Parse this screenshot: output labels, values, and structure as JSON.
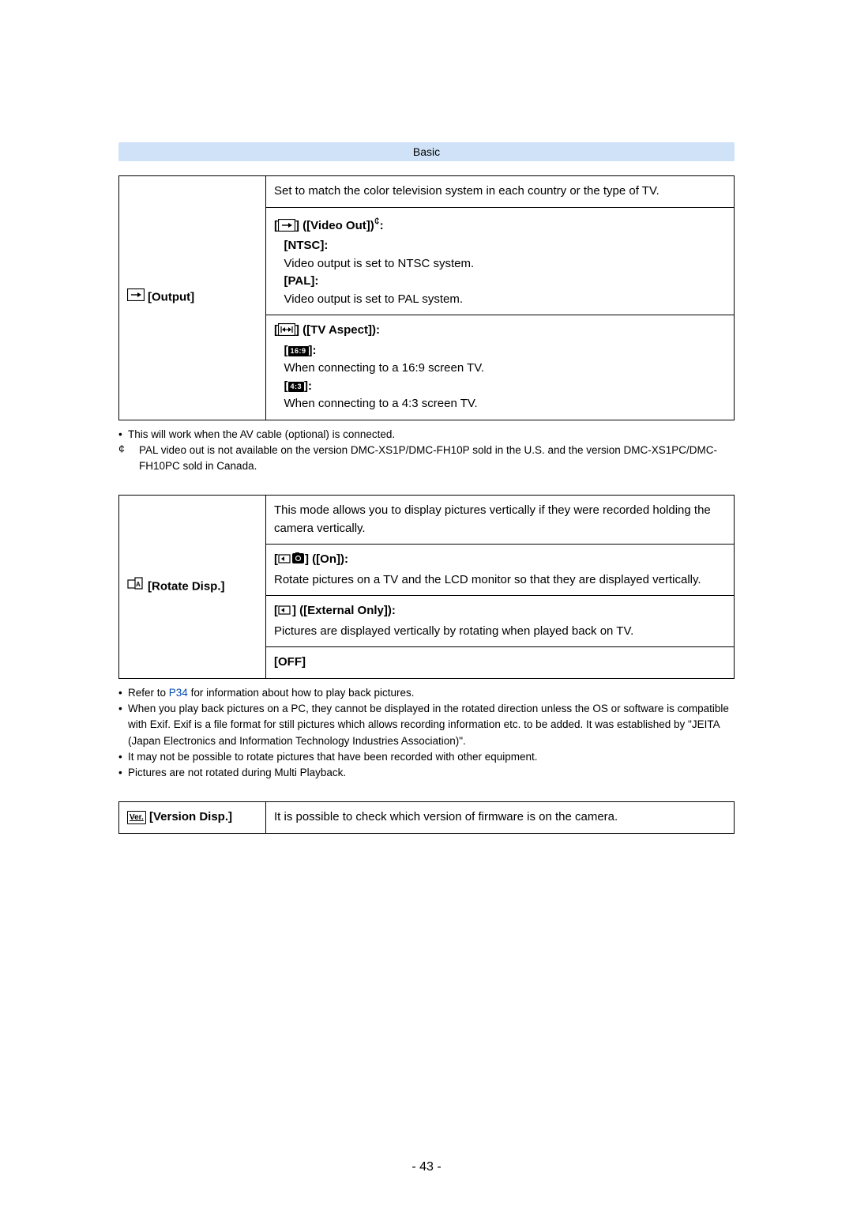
{
  "header": "Basic",
  "output": {
    "label": "[Output]",
    "row1": "Set to match the color television system in each country or the type of TV.",
    "video_out_title": "([Video Out])",
    "video_out_asterisk": "¢",
    "ntsc_label": "[NTSC]:",
    "ntsc_text": "Video output is set to NTSC system.",
    "pal_label": "[PAL]:",
    "pal_text": "Video output is set to PAL system.",
    "tv_aspect_title": "([TV Aspect]):",
    "opt169_val": "16:9",
    "opt169_text": "When connecting to a 16:9 screen TV.",
    "opt43_val": "4:3",
    "opt43_text": "When connecting to a 4:3 screen TV."
  },
  "output_notes": {
    "b1": "This will work when the AV cable (optional) is connected.",
    "a1": "PAL video out is not available on the version DMC-XS1P/DMC-FH10P sold in the U.S. and the version DMC-XS1PC/DMC-FH10PC sold in Canada."
  },
  "rotate": {
    "label": "[Rotate Disp.]",
    "row1": "This mode allows you to display pictures vertically if they were recorded holding the camera vertically.",
    "on_title": "([On]):",
    "on_text": "Rotate pictures on a TV and the LCD monitor so that they are displayed vertically.",
    "ext_title": "([External Only]):",
    "ext_text": "Pictures are displayed vertically by rotating when played back on TV.",
    "off_label": "[OFF]"
  },
  "rotate_notes": {
    "b1_pre": "Refer to ",
    "b1_link": "P34",
    "b1_post": " for information about how to play back pictures.",
    "b2": "When you play back pictures on a PC, they cannot be displayed in the rotated direction unless the OS or software is compatible with Exif. Exif is a file format for still pictures which allows recording information etc. to be added. It was established by \"JEITA (Japan Electronics and Information Technology Industries Association)\".",
    "b3": "It may not be possible to rotate pictures that have been recorded with other equipment.",
    "b4": "Pictures are not rotated during Multi Playback."
  },
  "version": {
    "icon_text": "Ver.",
    "label": "[Version Disp.]",
    "text": "It is possible to check which version of firmware is on the camera."
  },
  "page_number": "- 43 -"
}
